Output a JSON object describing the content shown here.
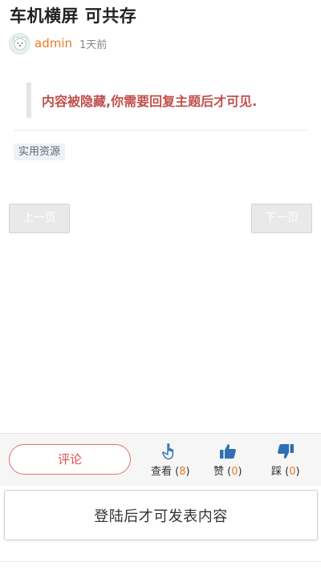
{
  "post": {
    "title": "车机横屏 可共存",
    "author": "admin",
    "time_ago": "1天前",
    "hidden_notice": "内容被隐藏,你需要回复主题后才可见.",
    "tag": "实用资源"
  },
  "pagination": {
    "prev_label": "上一页",
    "next_label": "下一页"
  },
  "actions": {
    "comment_label": "评论",
    "view_label": "查看",
    "view_count": "8",
    "like_label": "赞",
    "like_count": "0",
    "dislike_label": "踩",
    "dislike_count": "0"
  },
  "login_prompt": "登陆后才可发表内容",
  "icons": {
    "avatar": "bear-avatar-icon",
    "view": "pointing-hand-icon",
    "like": "thumbs-up-icon",
    "dislike": "thumbs-down-icon"
  },
  "colors": {
    "author": "#e67e22",
    "hidden_text": "#c0504d",
    "comment_border": "#e07070",
    "icon_blue": "#2f6fb3",
    "count": "#e67e22"
  }
}
